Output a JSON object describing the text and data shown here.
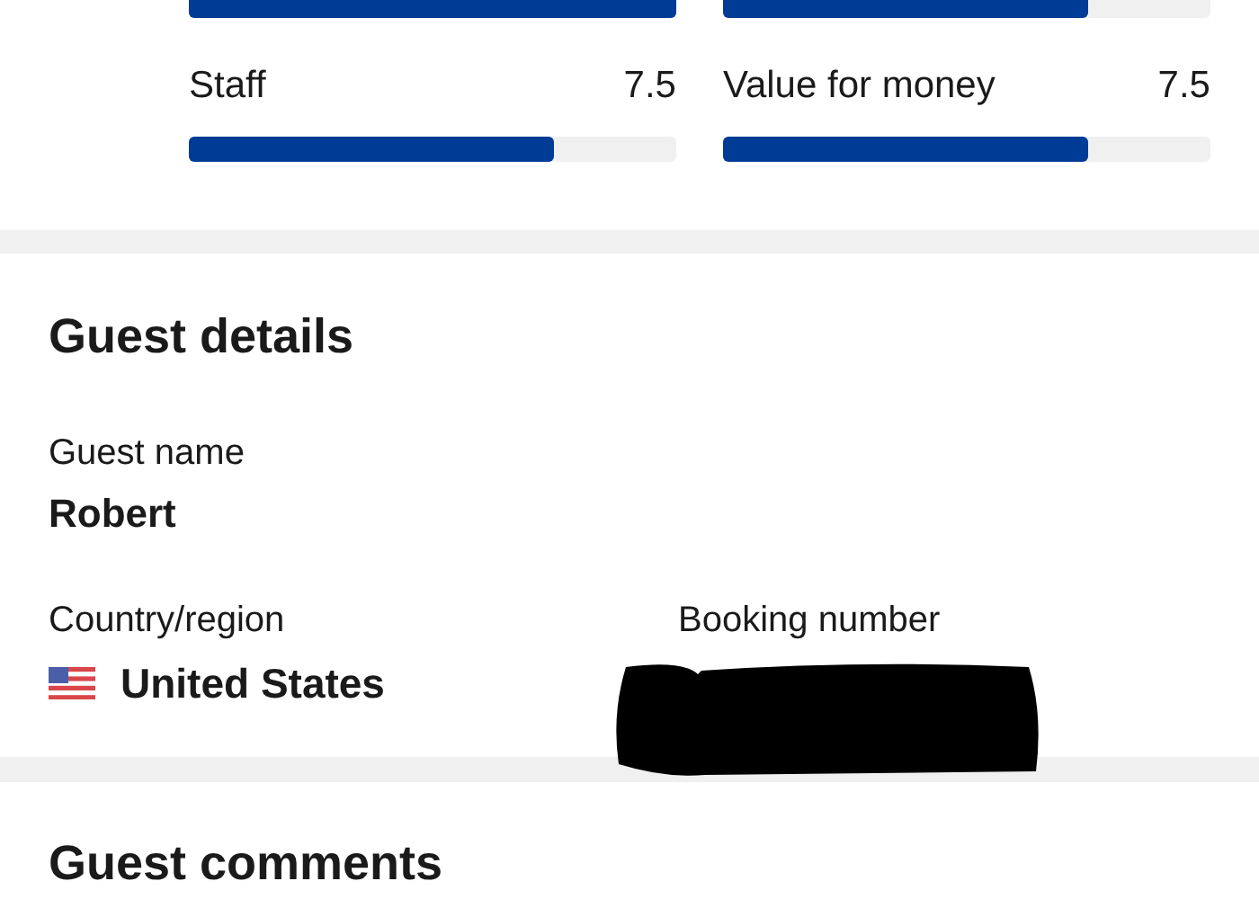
{
  "ratings": [
    {
      "level": 1.0
    },
    {
      "level": 0.75
    },
    {
      "label": "Staff",
      "score": "7.5",
      "level": 0.75
    },
    {
      "label": "Value for money",
      "score": "7.5",
      "level": 0.75
    }
  ],
  "guest_details": {
    "title": "Guest details",
    "guest_name_label": "Guest name",
    "guest_name": "Robert",
    "country_label": "Country/region",
    "country": "United States",
    "booking_label": "Booking number",
    "booking_redacted": true
  },
  "guest_comments": {
    "title": "Guest comments"
  }
}
